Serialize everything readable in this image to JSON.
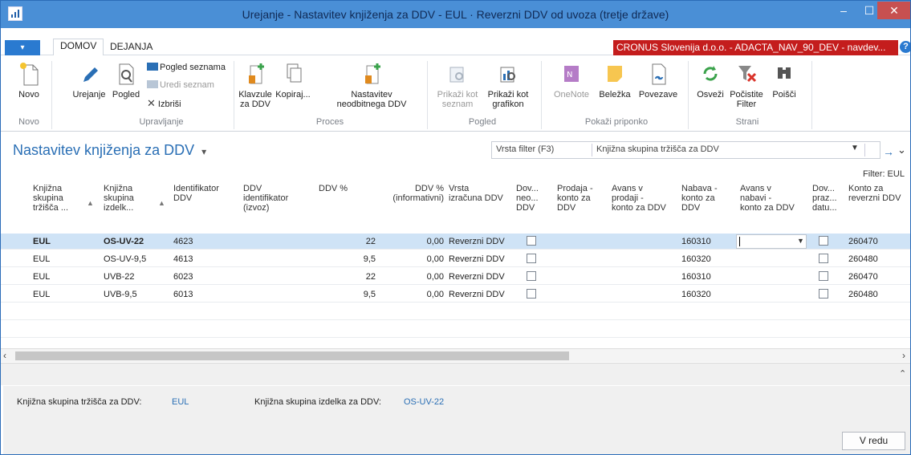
{
  "window": {
    "title": "Urejanje - Nastavitev knjiženja za DDV - EUL · Reverzni DDV od uvoza (tretje države)",
    "minimize": "–",
    "maximize": "☐",
    "close": "✕"
  },
  "tabs": {
    "file": "▾",
    "home": "DOMOV",
    "actions": "DEJANJA",
    "company": "CRONUS Slovenija d.o.o. - ADACTA_NAV_90_DEV - navdev...",
    "help": "?"
  },
  "ribbon": {
    "novo": "Novo",
    "urejanje": "Urejanje",
    "pogled": "Pogled",
    "pogled_seznama": "Pogled seznama",
    "uredi_seznam": "Uredi seznam",
    "izbrisi": "Izbriši",
    "klavzule_1": "Klavzule",
    "klavzule_2": "za DDV",
    "kopiraj": "Kopiraj...",
    "nastavitev_1": "Nastavitev",
    "nastavitev_2": "neodbitnega DDV",
    "prikazi_seznam_1": "Prikaži kot",
    "prikazi_seznam_2": "seznam",
    "prikazi_grafikon_1": "Prikaži kot",
    "prikazi_grafikon_2": "grafikon",
    "onenote": "OneNote",
    "belezka": "Beležka",
    "povezave": "Povezave",
    "osvezi": "Osveži",
    "pocistite_1": "Počistite",
    "pocistite_2": "Filter",
    "poisci": "Poišči",
    "groups": {
      "novo": "Novo",
      "upravljanje": "Upravljanje",
      "proces": "Proces",
      "pogled": "Pogled",
      "prikazi_priponko": "Pokaži priponko",
      "strani": "Strani"
    }
  },
  "page": {
    "title": "Nastavitev knjiženja za DDV",
    "title_dropdown": "▾",
    "filter_type": "Vrsta filter (F3)",
    "filter_field": "Knjižna skupina tržišča za DDV",
    "filter_info": "Filter: EUL"
  },
  "columns": [
    {
      "l1": "Knjižna",
      "l2": "skupina",
      "l3": "tržišča ..."
    },
    {
      "l1": "Knjižna",
      "l2": "skupina",
      "l3": "izdelk..."
    },
    {
      "l1": "Identifikator",
      "l2": "DDV",
      "l3": ""
    },
    {
      "l1": "DDV",
      "l2": "identifikator",
      "l3": "(izvoz)"
    },
    {
      "l1": "DDV %",
      "l2": "",
      "l3": ""
    },
    {
      "l1": "DDV %",
      "l2": "(informativni)",
      "l3": ""
    },
    {
      "l1": "Vrsta",
      "l2": "izračuna DDV",
      "l3": ""
    },
    {
      "l1": "Dov...",
      "l2": "neo...",
      "l3": "DDV"
    },
    {
      "l1": "Prodaja -",
      "l2": "konto za",
      "l3": "DDV"
    },
    {
      "l1": "Avans v",
      "l2": "prodaji -",
      "l3": "konto za DDV"
    },
    {
      "l1": "Nabava -",
      "l2": "konto za",
      "l3": "DDV"
    },
    {
      "l1": "Avans v",
      "l2": "nabavi -",
      "l3": "konto za DDV"
    },
    {
      "l1": "Dov...",
      "l2": "praz...",
      "l3": "datu..."
    },
    {
      "l1": "Konto za",
      "l2": "reverzni DDV",
      "l3": ""
    }
  ],
  "rows": [
    {
      "market": "EUL",
      "product": "OS-UV-22",
      "ident": "4623",
      "pct": "22",
      "info": "0,00",
      "calc": "Reverzni DDV",
      "purchase": "160310",
      "reverse": "260470"
    },
    {
      "market": "EUL",
      "product": "OS-UV-9,5",
      "ident": "4613",
      "pct": "9,5",
      "info": "0,00",
      "calc": "Reverzni DDV",
      "purchase": "160320",
      "reverse": "260480"
    },
    {
      "market": "EUL",
      "product": "UVB-22",
      "ident": "6023",
      "pct": "22",
      "info": "0,00",
      "calc": "Reverzni DDV",
      "purchase": "160310",
      "reverse": "260470"
    },
    {
      "market": "EUL",
      "product": "UVB-9,5",
      "ident": "6013",
      "pct": "9,5",
      "info": "0,00",
      "calc": "Reverzni DDV",
      "purchase": "160320",
      "reverse": "260480"
    }
  ],
  "factbox": {
    "market_label": "Knjižna skupina tržišča za DDV:",
    "market_value": "EUL",
    "product_label": "Knjižna skupina izdelka za DDV:",
    "product_value": "OS-UV-22"
  },
  "ok_button": "V redu"
}
